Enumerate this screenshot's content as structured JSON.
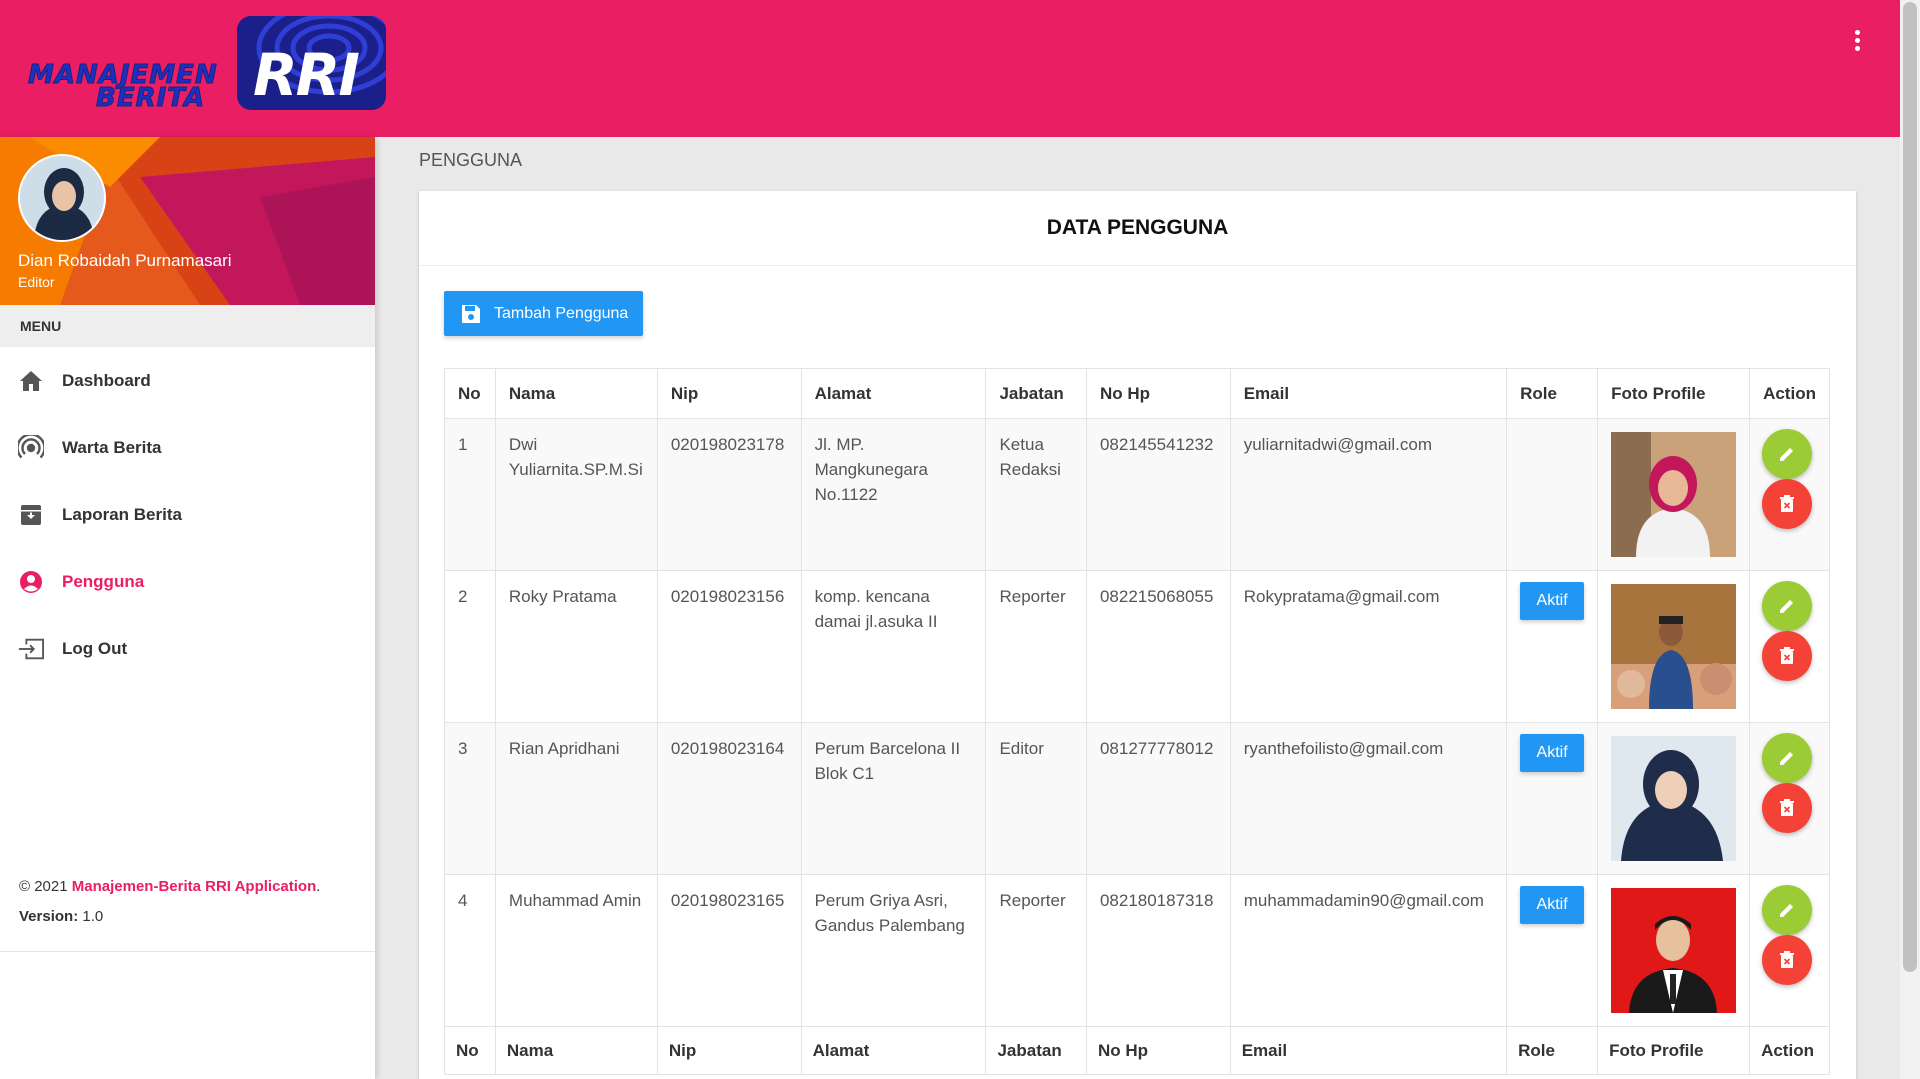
{
  "app": {
    "logo_line1": "MANAJEMEN",
    "logo_line2": "BERITA",
    "logo_rri": "RRI"
  },
  "user": {
    "name": "Dian Robaidah Purnamasari",
    "role": "Editor"
  },
  "sidebar": {
    "menu_header": "MENU",
    "items": [
      {
        "label": "Dashboard",
        "icon": "home-icon",
        "active": false
      },
      {
        "label": "Warta Berita",
        "icon": "broadcast-icon",
        "active": false
      },
      {
        "label": "Laporan Berita",
        "icon": "archive-icon",
        "active": false
      },
      {
        "label": "Pengguna",
        "icon": "account-circle-icon",
        "active": true
      },
      {
        "label": "Log Out",
        "icon": "logout-icon",
        "active": false
      }
    ],
    "footer": {
      "copyright_prefix": "© 2021",
      "brand": "Manajemen-Berita RRI Application",
      "suffix": ".",
      "version_label": "Version:",
      "version_value": "1.0"
    }
  },
  "breadcrumb": "PENGGUNA",
  "card": {
    "title": "DATA PENGGUNA",
    "add_button": "Tambah Pengguna"
  },
  "table": {
    "columns": [
      "No",
      "Nama",
      "Nip",
      "Alamat",
      "Jabatan",
      "No Hp",
      "Email",
      "Role",
      "Foto Profile",
      "Action"
    ],
    "rows": [
      {
        "no": "1",
        "nama": "Dwi Yuliarnita.SP.M.Si",
        "nip": "020198023178",
        "alamat": "Jl. MP. Mangkunegara No.1122",
        "jabatan": "Ketua Redaksi",
        "nohp": "082145541232",
        "email": "yuliarnitadwi@gmail.com",
        "role": ""
      },
      {
        "no": "2",
        "nama": "Roky Pratama",
        "nip": "020198023156",
        "alamat": "komp. kencana damai jl.asuka II",
        "jabatan": "Reporter",
        "nohp": "082215068055",
        "email": "Rokypratama@gmail.com",
        "role": "Aktif"
      },
      {
        "no": "3",
        "nama": "Rian Apridhani",
        "nip": "020198023164",
        "alamat": "Perum Barcelona II Blok C1",
        "jabatan": "Editor",
        "nohp": "081277778012",
        "email": "ryanthefoilisto@gmail.com",
        "role": "Aktif"
      },
      {
        "no": "4",
        "nama": "Muhammad Amin",
        "nip": "020198023165",
        "alamat": "Perum Griya Asri, Gandus Palembang",
        "jabatan": "Reporter",
        "nohp": "082180187318",
        "email": "muhammadamin90@gmail.com",
        "role": "Aktif"
      }
    ]
  },
  "colors": {
    "primary": "#e91e63",
    "button_blue": "#2196f3",
    "edit_green": "#9ccc35",
    "delete_red": "#f44336"
  }
}
